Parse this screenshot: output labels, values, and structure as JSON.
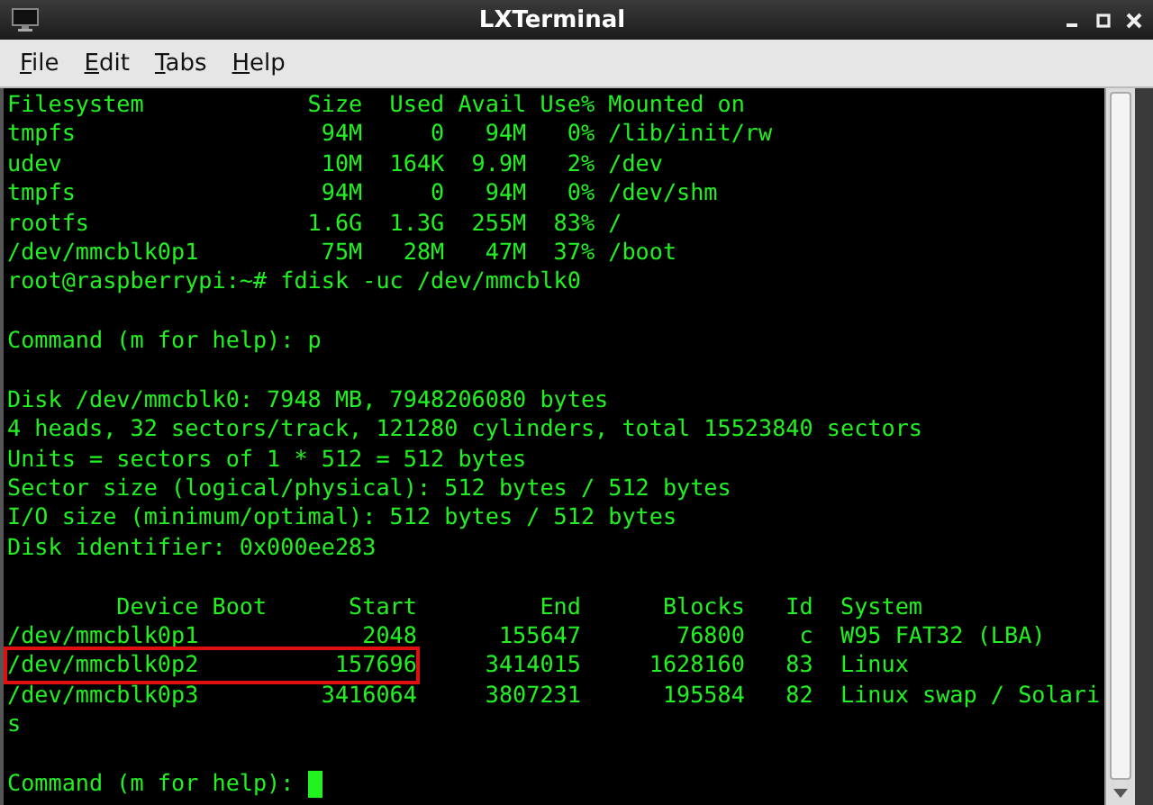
{
  "window": {
    "title": "LXTerminal"
  },
  "menu": [
    "File",
    "Edit",
    "Tabs",
    "Help"
  ],
  "terminal": {
    "lines": [
      {
        "text": "Filesystem            Size  Used Avail Use% Mounted on"
      },
      {
        "text": "tmpfs                  94M     0   94M   0% /lib/init/rw"
      },
      {
        "text": "udev                   10M  164K  9.9M   2% /dev"
      },
      {
        "text": "tmpfs                  94M     0   94M   0% /dev/shm"
      },
      {
        "text": "rootfs                1.6G  1.3G  255M  83% /"
      },
      {
        "text": "/dev/mmcblk0p1         75M   28M   47M  37% /boot"
      },
      {
        "text": "root@raspberrypi:~# fdisk -uc /dev/mmcblk0"
      },
      {
        "text": "Command (m for help): p",
        "space_before": true
      },
      {
        "text": "Disk /dev/mmcblk0: 7948 MB, 7948206080 bytes",
        "space_before": true
      },
      {
        "text": "4 heads, 32 sectors/track, 121280 cylinders, total 15523840 sectors"
      },
      {
        "text": "Units = sectors of 1 * 512 = 512 bytes"
      },
      {
        "text": "Sector size (logical/physical): 512 bytes / 512 bytes"
      },
      {
        "text": "I/O size (minimum/optimal): 512 bytes / 512 bytes"
      },
      {
        "text": "Disk identifier: 0x000ee283"
      },
      {
        "text": "        Device Boot      Start         End      Blocks   Id  System",
        "space_before": true
      },
      {
        "text": "/dev/mmcblk0p1            2048      155647       76800    c  W95 FAT32 (LBA)"
      },
      {
        "boxed": "/dev/mmcblk0p2          157696",
        "text": "     3414015     1628160   83  Linux"
      },
      {
        "text": "/dev/mmcblk0p3         3416064     3807231      195584   82  Linux swap / Solari"
      },
      {
        "text": "s"
      },
      {
        "text": "Command (m for help): ",
        "space_before": true,
        "cursor": true
      }
    ]
  }
}
